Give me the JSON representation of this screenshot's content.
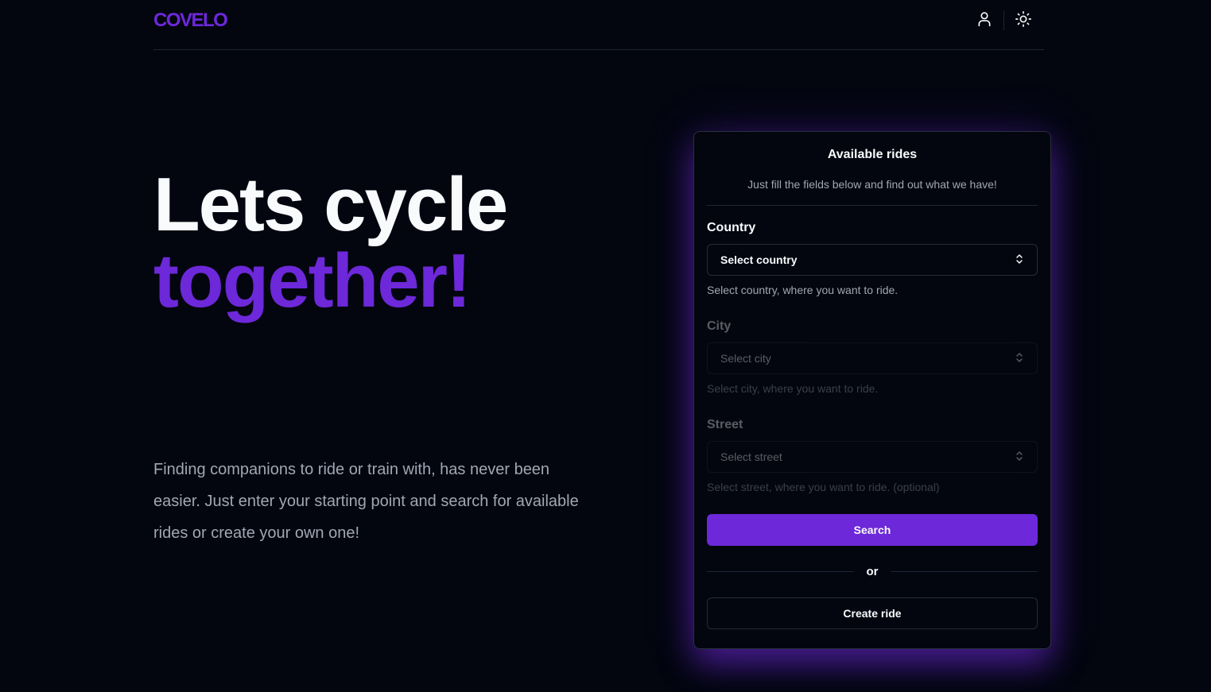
{
  "header": {
    "logo": "COVELO",
    "icons": [
      "user-icon",
      "sun-moon-icon"
    ]
  },
  "hero": {
    "title_line1": "Lets cycle",
    "title_line2": "together!",
    "description": "Finding companions to ride or train with, has never been easier. Just enter your starting point and search for available rides or create your own one!"
  },
  "card": {
    "title": "Available rides",
    "subtitle": "Just fill the fields below and find out what we have!",
    "country": {
      "label": "Country",
      "placeholder": "Select country",
      "help": "Select country, where you want to ride."
    },
    "city": {
      "label": "City",
      "placeholder": "Select city",
      "help": "Select city, where you want to ride."
    },
    "street": {
      "label": "Street",
      "placeholder": "Select street",
      "help": "Select street, where you want to ride. (optional)"
    },
    "search_label": "Search",
    "or_label": "or",
    "create_label": "Create ride"
  },
  "colors": {
    "background": "#03060f",
    "accent": "#6d28d9",
    "text": "#f8fafc",
    "muted": "#a1a7b3"
  }
}
